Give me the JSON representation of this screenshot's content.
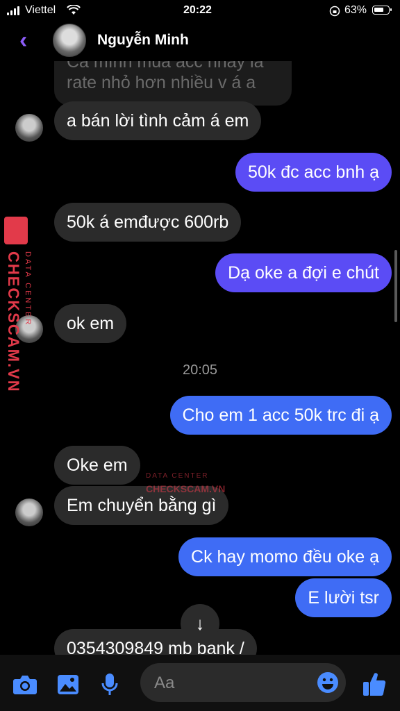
{
  "status_bar": {
    "carrier": "Viettel",
    "time": "20:22",
    "battery": "63%"
  },
  "header": {
    "contact_name": "Nguyễn Minh"
  },
  "messages": {
    "m0_line1": "Cá mình mua acc nhay là",
    "m0_line2": "rate nhỏ hơn nhiều v á a",
    "m1": "a bán lời tình cảm á em",
    "m2": "50k đc acc bnh ạ",
    "m3": "50k á emđược 600rb",
    "m4": "Dạ oke a đợi e chút",
    "m5": "ok em",
    "timestamp": "20:05",
    "m6": "Cho em 1 acc 50k trc đi ạ",
    "m7": "Oke em",
    "m8": "Em chuyển bằng gì",
    "m9": "Ck hay momo đều oke ạ",
    "m10": "E lười tsr",
    "m11": "0354309849 mb bank /"
  },
  "watermark": {
    "brand": "CHECKSCAM.VN",
    "sub": "DATA CENTER"
  },
  "composer": {
    "placeholder": "Aa"
  },
  "colors": {
    "accent": "#8b5cf6",
    "out_purple": "#5b4cf5",
    "out_blue": "#3f6cf5",
    "icon_blue": "#4a8cff"
  }
}
